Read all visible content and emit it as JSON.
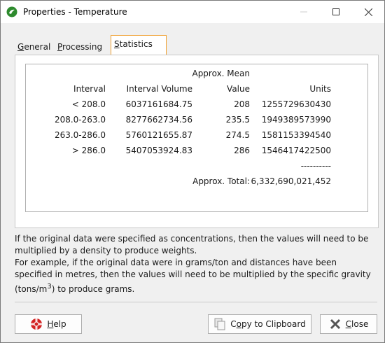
{
  "window": {
    "title": "Properties - Temperature"
  },
  "tabs": [
    {
      "label": "General",
      "mnemonic": "G",
      "rest": "eneral"
    },
    {
      "label": "Processing",
      "mnemonic": "P",
      "rest": "rocessing"
    },
    {
      "label": "Statistics",
      "mnemonic": "S",
      "rest": "tatistics"
    }
  ],
  "table": {
    "header_top": "Approx. Mean",
    "headers": [
      "Interval",
      "Interval Volume",
      "Value",
      "Units"
    ],
    "rows": [
      {
        "interval": "< 208.0",
        "volume": "6037161684.75",
        "mean": "208",
        "units": "1255729630430"
      },
      {
        "interval": "208.0-263.0",
        "volume": "8277662734.56",
        "mean": "235.5",
        "units": "1949389573990"
      },
      {
        "interval": "263.0-286.0",
        "volume": "5760121655.87",
        "mean": "274.5",
        "units": "1581153394540"
      },
      {
        "interval": "> 286.0",
        "volume": "5407053924.83",
        "mean": "286",
        "units": "1546417422500"
      }
    ],
    "dashes": "----------",
    "total_label": "Approx. Total:",
    "total_value": "6,332,690,021,452"
  },
  "note": {
    "line1": "If the original data were specified as concentrations, then the values will need to be multiplied by a density to produce weights.",
    "line2": "For example, if the original data were in grams/ton and distances have been specified in metres, then the values will need to be multiplied by the specific gravity (tons/m",
    "sup": "3",
    "line2_end": ") to produce grams."
  },
  "buttons": {
    "help": {
      "mnemonic": "H",
      "rest": "elp"
    },
    "copy": {
      "pre": "C",
      "mnemonic": "o",
      "rest": "py to Clipboard"
    },
    "close": {
      "mnemonic": "C",
      "rest": "lose"
    }
  },
  "colors": {
    "accent_tab_border": "#f0a030",
    "app_icon": "#2e8b2e"
  }
}
